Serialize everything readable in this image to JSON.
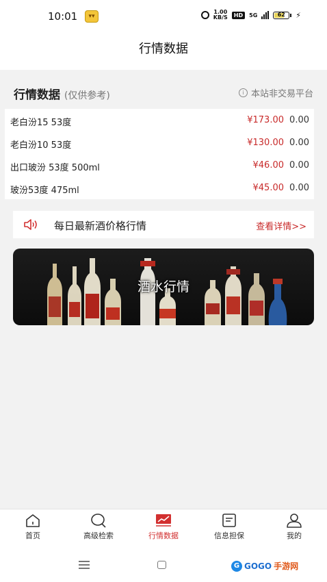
{
  "status_bar": {
    "time": "10:01",
    "speed": "1.00\nKB/S",
    "hd": "HD",
    "network": "5G",
    "battery": "62"
  },
  "header": {
    "title": "行情数据"
  },
  "section": {
    "title": "行情数据",
    "subtitle": "(仅供参考)",
    "disclaimer": "本站非交易平台"
  },
  "prices": [
    {
      "name": "老白汾15 53度",
      "price": "¥173.00",
      "change": "0.00"
    },
    {
      "name": "老白汾10 53度",
      "price": "¥130.00",
      "change": "0.00"
    },
    {
      "name": "出口玻汾 53度 500ml",
      "price": "¥46.00",
      "change": "0.00"
    },
    {
      "name": "玻汾53度 475ml",
      "price": "¥45.00",
      "change": "0.00"
    }
  ],
  "notice": {
    "text": "每日最新酒价格行情",
    "more": "查看详情>>"
  },
  "banner": {
    "caption": "酒水行情"
  },
  "tabs": [
    {
      "label": "首页",
      "icon": "home-icon"
    },
    {
      "label": "高级检索",
      "icon": "search-icon"
    },
    {
      "label": "行情数据",
      "icon": "trend-chart-icon"
    },
    {
      "label": "信息担保",
      "icon": "document-icon"
    },
    {
      "label": "我的",
      "icon": "user-icon"
    }
  ],
  "nav": {
    "logo_left": "GOGO",
    "logo_right": "手游网"
  },
  "colors": {
    "accent": "#c82a2a",
    "tab_active": "#d23030"
  }
}
